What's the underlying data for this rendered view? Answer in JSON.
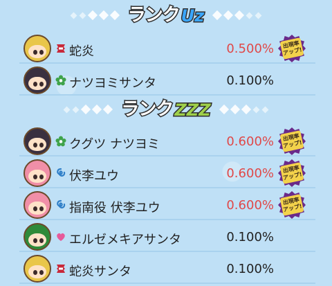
{
  "sections": [
    {
      "rank_label": "ランク",
      "rank_badge": "Uz",
      "rows": [
        {
          "name": "蛇炎",
          "rate": "0.500%",
          "rate_up": true,
          "tribe_icon": "red-tribe-icon",
          "tribe_color": "#c8283a",
          "hair": "#e9c64a",
          "avatar_border": "#6b4a2b"
        },
        {
          "name": "ナツヨミサンタ",
          "rate": "0.100%",
          "rate_up": false,
          "tribe_icon": "green-flower-tribe-icon",
          "tribe_color": "#3fa34a",
          "hair": "#3a3040",
          "avatar_border": "#6b4a2b"
        }
      ]
    },
    {
      "rank_label": "ランク",
      "rank_badge": "ZZZ",
      "rows": [
        {
          "name": "クグツ ナツヨミ",
          "rate": "0.600%",
          "rate_up": true,
          "tribe_icon": "green-flower-tribe-icon",
          "tribe_color": "#3fa34a",
          "hair": "#3a3040",
          "avatar_border": "#6b4a2b"
        },
        {
          "name": "伏李ユウ",
          "rate": "0.600%",
          "rate_up": true,
          "tribe_icon": "blue-swirl-tribe-icon",
          "tribe_color": "#2f7fc8",
          "hair": "#f08fa8",
          "avatar_border": "#6b4a2b"
        },
        {
          "name": "指南役 伏李ユウ",
          "rate": "0.600%",
          "rate_up": true,
          "tribe_icon": "blue-swirl-tribe-icon",
          "tribe_color": "#2f7fc8",
          "hair": "#f08fa8",
          "avatar_border": "#6b4a2b"
        },
        {
          "name": "エルゼメキアサンタ",
          "rate": "0.100%",
          "rate_up": false,
          "tribe_icon": "pink-heart-tribe-icon",
          "tribe_color": "#e65a9a",
          "hair": "#2f8a3a",
          "avatar_border": "#6b4a2b"
        },
        {
          "name": "蛇炎サンタ",
          "rate": "0.100%",
          "rate_up": false,
          "tribe_icon": "red-tribe-icon",
          "tribe_color": "#c8283a",
          "hair": "#e9c64a",
          "avatar_border": "#6b4a2b"
        }
      ]
    }
  ],
  "up_badge": {
    "line1": "出現率",
    "line2": "アップ!"
  },
  "colors": {
    "rate_up": "#e04848",
    "rate_normal": "#222222",
    "background": "#bfe0f6"
  }
}
